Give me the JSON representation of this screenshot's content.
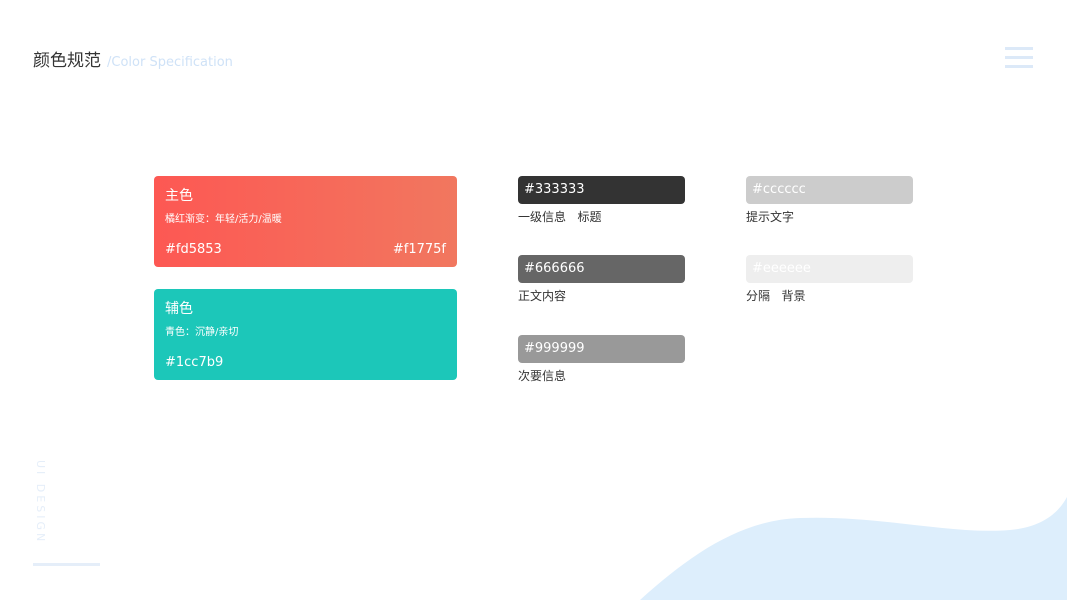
{
  "header": {
    "title": "颜色规范",
    "subtitle": "/Color Specification"
  },
  "colors": {
    "primary_start": "#fd5853",
    "primary_end": "#f1775f",
    "secondary": "#1cc7b9",
    "wave": "#ddeefc",
    "menu": "#dce9f8"
  },
  "primary": {
    "name": "主色",
    "desc": "橘红渐变：年轻/活力/温暖",
    "hex_start": "#fd5853",
    "hex_end": "#f1775f"
  },
  "secondary": {
    "name": "辅色",
    "desc": "青色：沉静/亲切",
    "hex": "#1cc7b9"
  },
  "swatches": [
    {
      "hex": "#333333",
      "label": "一级信息   标题"
    },
    {
      "hex": "#666666",
      "label": "正文内容"
    },
    {
      "hex": "#999999",
      "label": "次要信息"
    },
    {
      "hex": "#cccccc",
      "label": "提示文字"
    },
    {
      "hex": "#eeeeee",
      "label": "分隔   背景"
    }
  ],
  "side": {
    "vertical_text": "UI DESIGN"
  },
  "icons": {
    "menu": "menu-icon"
  }
}
